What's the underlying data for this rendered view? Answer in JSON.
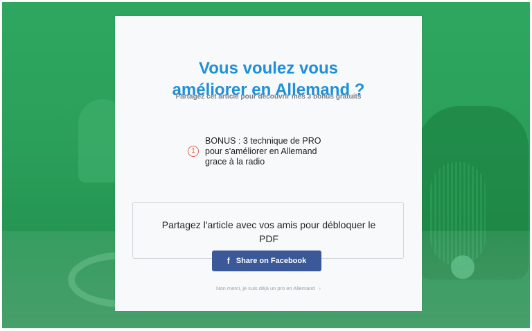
{
  "modal": {
    "title_line1": "Vous voulez vous",
    "title_line2": "améliorer en Allemand ?",
    "subtitle": "Partagez cet article pour découvrir mes 3 bonus gratuits"
  },
  "bonus": {
    "number": "1",
    "line1": "BONUS : 3 technique de PRO",
    "line2": "pour s'améliorer en Allemand",
    "line3": "grace à la radio"
  },
  "share": {
    "line1": "Partagez l'article avec vos amis pour débloquer le",
    "line2": "PDF",
    "button_label": "Share on Facebook",
    "button_icon": "f"
  },
  "decline": {
    "label": "Non merci, je suis déjà un pro en Allemand",
    "arrow": "›"
  },
  "colors": {
    "accent": "#1e90d8",
    "facebook": "#3b5998",
    "background_green": "#2fa760",
    "bonus_number": "#e2604a"
  }
}
